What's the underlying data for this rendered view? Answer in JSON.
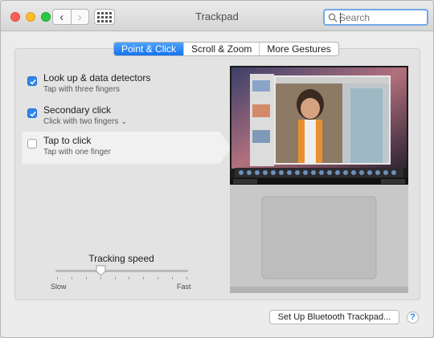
{
  "window": {
    "title": "Trackpad"
  },
  "toolbar": {
    "back_icon": "chevron-left-icon",
    "forward_icon": "chevron-right-icon",
    "grid_icon": "show-all-grid-icon",
    "back_glyph": "‹",
    "forward_glyph": "›"
  },
  "search": {
    "placeholder": "Search",
    "icon": "magnifier-icon"
  },
  "tabs": [
    {
      "label": "Point & Click",
      "active": true
    },
    {
      "label": "Scroll & Zoom",
      "active": false
    },
    {
      "label": "More Gestures",
      "active": false
    }
  ],
  "options": [
    {
      "title": "Look up & data detectors",
      "subtitle": "Tap with three fingers",
      "checked": true
    },
    {
      "title": "Secondary click",
      "subtitle": "Click with two fingers",
      "checked": true,
      "has_menu": true,
      "menu_glyph": "⌄"
    },
    {
      "title": "Tap to click",
      "subtitle": "Tap with one finger",
      "checked": false,
      "selected": true
    }
  ],
  "tracking": {
    "label": "Tracking speed",
    "min_label": "Slow",
    "max_label": "Fast",
    "value": 0.34,
    "ticks": 10
  },
  "footer": {
    "setup_button": "Set Up Bluetooth Trackpad...",
    "help": "?"
  },
  "colors": {
    "accent": "#1573f0",
    "checkbox": "#2e86ef",
    "close": "#fc5f57",
    "minimize": "#fdbc2e",
    "zoom": "#29c840"
  }
}
